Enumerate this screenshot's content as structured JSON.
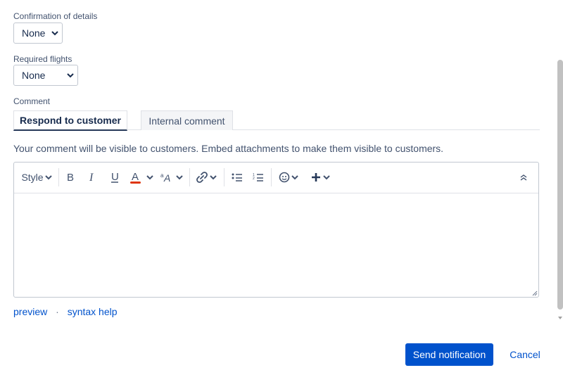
{
  "fields": {
    "confirmation": {
      "label": "Confirmation of details",
      "value": "None"
    },
    "required_flights": {
      "label": "Required flights",
      "value": "None"
    }
  },
  "comment": {
    "label": "Comment",
    "tabs": [
      {
        "label": "Respond to customer",
        "active": true
      },
      {
        "label": "Internal comment",
        "active": false
      }
    ],
    "hint": "Your comment will be visible to customers. Embed attachments to make them visible to customers."
  },
  "toolbar": {
    "style_label": "Style",
    "icons": [
      "bold-icon",
      "italic-icon",
      "underline-icon",
      "text-color-icon",
      "text-format-icon",
      "link-icon",
      "bullet-list-icon",
      "numbered-list-icon",
      "emoji-icon",
      "insert-plus-icon",
      "collapse-toolbar-icon"
    ],
    "text_color_accent": "#de350b"
  },
  "links": {
    "preview": "preview",
    "separator": "·",
    "syntax_help": "syntax help"
  },
  "actions": {
    "primary": "Send notification",
    "secondary": "Cancel"
  },
  "colors": {
    "primary": "#0052cc",
    "text": "#172b4d",
    "muted": "#42526e"
  }
}
